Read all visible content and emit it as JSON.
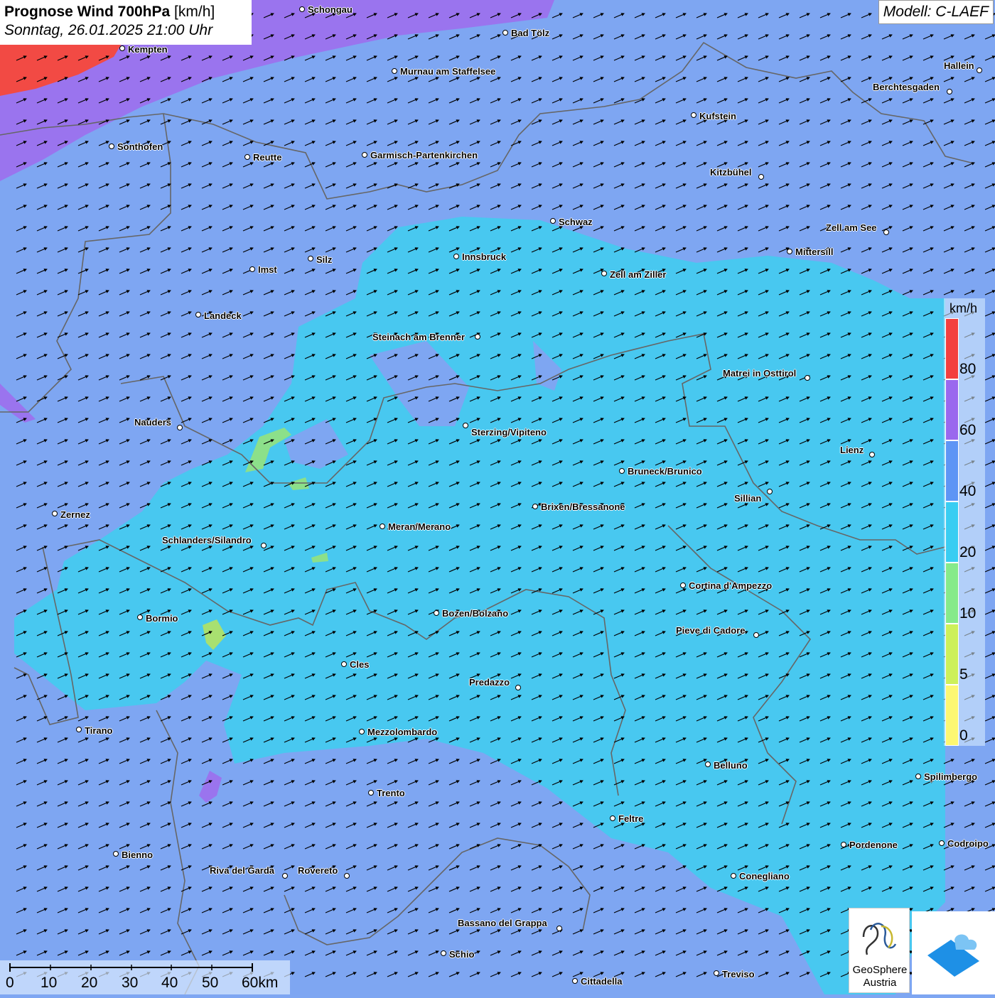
{
  "header": {
    "title_bold": "Prognose Wind 700hPa",
    "title_unit": "[km/h]",
    "subtitle": "Sonntag, 26.01.2025 21:00 Uhr",
    "model": "Modell: C-LAEF"
  },
  "legend": {
    "unit": "km/h",
    "ticks": [
      "0",
      "5",
      "10",
      "20",
      "40",
      "60",
      "80"
    ],
    "colors": [
      "#fdf772",
      "#cdf05a",
      "#86ea8a",
      "#39cdf2",
      "#5e95f5",
      "#9a68ee",
      "#f33f3f"
    ]
  },
  "scale_bar": {
    "labels": [
      "0",
      "10",
      "20",
      "30",
      "40",
      "50",
      "60km"
    ]
  },
  "logos": {
    "geosphere_line1": "GeoSphere",
    "geosphere_line2": "Austria",
    "app_icon": "cloud-app-icon"
  },
  "cities": [
    "Schongau",
    "Bad Tölz",
    "Kempten",
    "Murnau am Staffelsee",
    "Hallein",
    "Berchtesgaden",
    "Kufstein",
    "Sonthofen",
    "Reutte",
    "Garmisch-Partenkirchen",
    "Kitzbühel",
    "Schwaz",
    "Zell am See",
    "Mittersill",
    "Innsbruck",
    "Silz",
    "Imst",
    "Zell am Ziller",
    "Landeck",
    "Steinach am Brenner",
    "Matrei in Osttirol",
    "Nauders",
    "Sterzing/Vipiteno",
    "Lienz",
    "Bruneck/Brunico",
    "Sillian",
    "Brixen/Bressanone",
    "Zernez",
    "Meran/Merano",
    "Schlanders/Silandro",
    "Cortina d'Ampezzo",
    "Bozen/Bolzano",
    "Bormio",
    "Pieve di Cadore",
    "Cles",
    "Predazzo",
    "Tirano",
    "Mezzolombardo",
    "Belluno",
    "Spilimbergo",
    "Trento",
    "Feltre",
    "Bienno",
    "Pordenone",
    "Codroipo",
    "Riva del Garda",
    "Rovereto",
    "Conegliano",
    "Bassano del Grappa",
    "Schio",
    "Treviso",
    "Cittadella"
  ]
}
